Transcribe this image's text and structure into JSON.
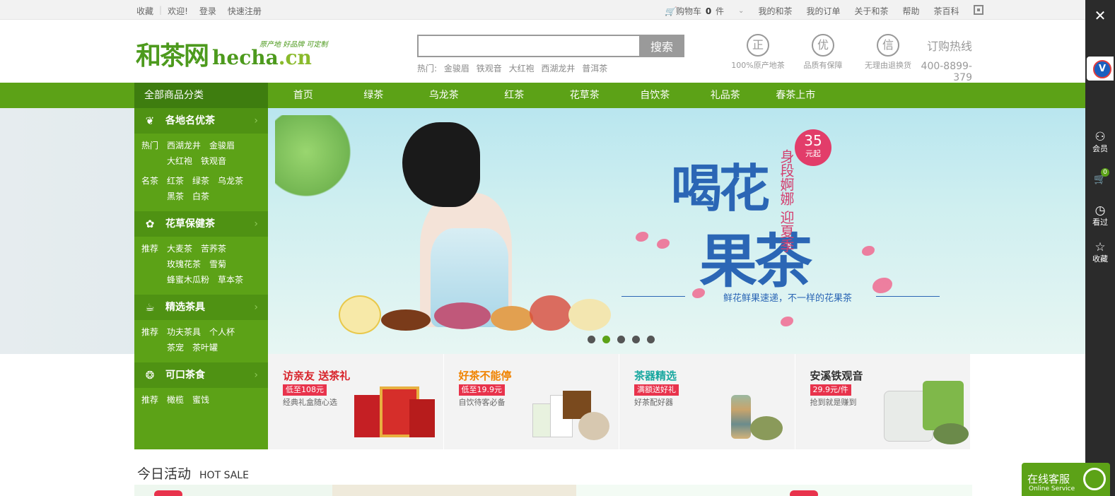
{
  "topbar": {
    "left": [
      "收藏",
      "欢迎!",
      "登录",
      "快速注册"
    ],
    "cart_label": "购物车",
    "cart_count": "0",
    "cart_unit": "件",
    "right": [
      "我的和茶",
      "我的订单",
      "关于和茶",
      "帮助",
      "茶百科"
    ]
  },
  "logo": {
    "cn": "和茶网",
    "en_a": "hecha",
    "en_b": ".cn",
    "slogan": "原产地 好品牌 可定制"
  },
  "search": {
    "value": "",
    "button": "搜索",
    "hot_label": "热门:",
    "hot_terms": [
      "金骏眉",
      "铁观音",
      "大红袍",
      "西湖龙井",
      "普洱茶"
    ]
  },
  "promises": [
    {
      "icon": "正",
      "label": "100%原产地茶"
    },
    {
      "icon": "优",
      "label": "品质有保障"
    },
    {
      "icon": "信",
      "label": "无理由退换货"
    }
  ],
  "hotline": {
    "title": "订购热线",
    "number": "400-8899-379"
  },
  "nav": {
    "all": "全部商品分类",
    "links": [
      "首页",
      "绿茶",
      "乌龙茶",
      "红茶",
      "花草茶",
      "自饮茶",
      "礼品茶",
      "春茶上市"
    ]
  },
  "categories": [
    {
      "title": "各地名优茶",
      "icon": "leaf-icon",
      "glyph": "❦",
      "rows": [
        {
          "k": "热门",
          "v": [
            "西湖龙井",
            "金骏眉",
            "大红袍",
            "铁观音"
          ]
        },
        {
          "k": "名茶",
          "v": [
            "红茶",
            "绿茶",
            "乌龙茶",
            "黑茶",
            "白茶"
          ]
        }
      ]
    },
    {
      "title": "花草保健茶",
      "icon": "rose-icon",
      "glyph": "✿",
      "rows": [
        {
          "k": "推荐",
          "v": [
            "大麦茶",
            "苦荞茶",
            "玫瑰花茶",
            "雪菊",
            "蜂蜜木瓜粉",
            "草本茶"
          ]
        }
      ]
    },
    {
      "title": "精选茶具",
      "icon": "teapot-icon",
      "glyph": "☕",
      "rows": [
        {
          "k": "推荐",
          "v": [
            "功夫茶具",
            "个人杯",
            "茶宠",
            "茶叶罐"
          ]
        }
      ]
    },
    {
      "title": "可口茶食",
      "icon": "snack-icon",
      "glyph": "❂",
      "rows": [
        {
          "k": "推荐",
          "v": [
            "橄榄",
            "蜜饯"
          ]
        }
      ]
    }
  ],
  "banner": {
    "headline_1": "喝花",
    "headline_2": "果茶",
    "side_text": "身段婀娜 迎夏季",
    "price": "35",
    "price_unit": "元起",
    "tagline": "鲜花鲜果速递，不一样的花果茶",
    "active_slide": 2,
    "slides": 5
  },
  "promos": [
    {
      "title": "访亲友 送茶礼",
      "color": "#d8232a",
      "tag": "低至108元",
      "sub": "经典礼盒随心选"
    },
    {
      "title": "好茶不能停",
      "color": "#f08300",
      "tag": "低至19.9元",
      "sub": "自饮待客必备"
    },
    {
      "title": "茶器精选",
      "color": "#1aa8a0",
      "tag": "满额送好礼",
      "sub": "好茶配好器"
    },
    {
      "title": "安溪铁观音",
      "color": "#333333",
      "tag": "29.9元/件",
      "sub": "抢到就是赚到"
    }
  ],
  "today": {
    "zh": "今日活动",
    "en": "HOT SALE"
  },
  "rightbar": {
    "items": [
      {
        "label": "会员",
        "glyph": "⚇"
      },
      {
        "label": "",
        "glyph": "🛒",
        "badge": "0"
      },
      {
        "label": "看过",
        "glyph": "◷"
      },
      {
        "label": "收藏",
        "glyph": "☆"
      }
    ]
  },
  "online": {
    "title": "在线客服",
    "sub": "Online Service"
  }
}
